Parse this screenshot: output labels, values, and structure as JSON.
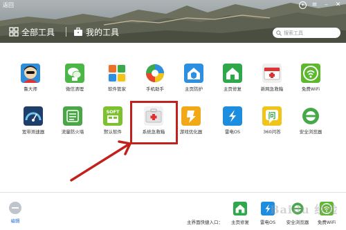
{
  "header": {
    "back_label": "返回",
    "tabs": [
      {
        "label": "全部工具",
        "icon": "grid-icon"
      },
      {
        "label": "我的工具",
        "icon": "briefcase-icon"
      }
    ],
    "search_placeholder": "搜索工具",
    "window_controls": [
      "skin-icon",
      "menu-icon",
      "minimize-icon",
      "close-icon"
    ]
  },
  "tools": [
    {
      "label": "鲁大师",
      "icon": "ludashi-icon",
      "color": "#2e8fd8"
    },
    {
      "label": "微信清理",
      "icon": "wechat-clean-icon",
      "color": "#4cb648"
    },
    {
      "label": "软件管家",
      "icon": "software-manager-icon",
      "color": "#e8722a"
    },
    {
      "label": "手机助手",
      "icon": "phone-assistant-icon",
      "color": "#3aa84b"
    },
    {
      "label": "主页防护",
      "icon": "homepage-protect-icon",
      "color": "#2d8fe0"
    },
    {
      "label": "主页修复",
      "icon": "homepage-repair-icon",
      "color": "#2ea84b"
    },
    {
      "label": "新网急救箱",
      "icon": "network-firstaid-icon",
      "color": "#e6e6e6"
    },
    {
      "label": "免费WiFi",
      "icon": "free-wifi-icon",
      "color": "#5cb82c"
    },
    {
      "label": "宽带测速器",
      "icon": "speedtest-icon",
      "color": "#1e3f6a"
    },
    {
      "label": "流量防火墙",
      "icon": "traffic-firewall-icon",
      "color": "#4aa646"
    },
    {
      "label": "默认软件",
      "icon": "default-software-icon",
      "color": "#7cc12e"
    },
    {
      "label": "系统急救箱",
      "icon": "system-firstaid-icon",
      "color": "#e0e0e0"
    },
    {
      "label": "游戏优化器",
      "icon": "game-optimizer-icon",
      "color": "#f2a918"
    },
    {
      "label": "雷电OS",
      "icon": "thunder-os-icon",
      "color": "#1d8de0"
    },
    {
      "label": "360问答",
      "icon": "qa-icon",
      "color": "#f0c419"
    },
    {
      "label": "安全浏览器",
      "icon": "safe-browser-icon",
      "color": "#47a84a"
    }
  ],
  "bottom": {
    "edit_label": "编辑",
    "quick_entry_label": "主界面快捷入口：",
    "quick_tools": [
      {
        "label": "主页修复",
        "icon": "homepage-repair-icon"
      },
      {
        "label": "雷电OS",
        "icon": "thunder-os-icon"
      },
      {
        "label": "安全浏览器",
        "icon": "safe-browser-icon"
      },
      {
        "label": "免费WiFi",
        "icon": "free-wifi-icon"
      }
    ]
  },
  "annotation": {
    "highlight_color": "#c1211c",
    "arrow_color": "#c1211c"
  },
  "watermark": "Baidu 经验"
}
